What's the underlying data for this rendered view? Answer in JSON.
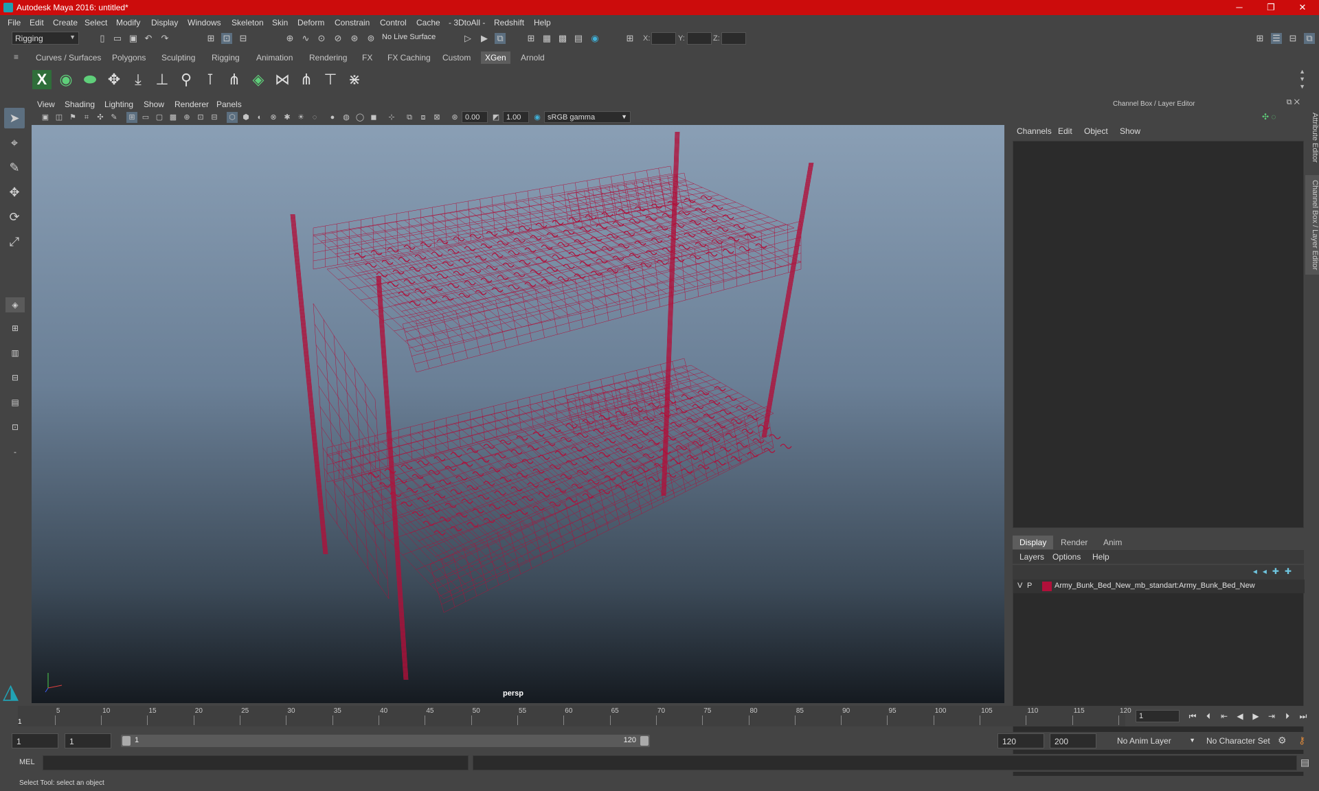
{
  "window": {
    "title": "Autodesk Maya 2016: untitled*",
    "minimize": "─",
    "maximize": "❐",
    "close": "✕"
  },
  "menu": [
    "File",
    "Edit",
    "Create",
    "Select",
    "Modify",
    "Display",
    "Windows",
    "Skeleton",
    "Skin",
    "Deform",
    "Constrain",
    "Control",
    "Cache",
    "- 3DtoAll -",
    "Redshift",
    "Help"
  ],
  "status": {
    "mode": "Rigging",
    "live_surface": "No Live Surface",
    "x_label": "X:",
    "y_label": "Y:",
    "z_label": "Z:"
  },
  "shelf_tabs": [
    "Curves / Surfaces",
    "Polygons",
    "Sculpting",
    "Rigging",
    "Animation",
    "Rendering",
    "FX",
    "FX Caching",
    "Custom",
    "XGen",
    "Arnold"
  ],
  "shelf_active": "XGen",
  "viewport": {
    "menu": [
      "View",
      "Shading",
      "Lighting",
      "Show",
      "Renderer",
      "Panels"
    ],
    "exposure": "0.00",
    "gamma": "1.00",
    "color_space": "sRGB gamma",
    "camera_label": "persp",
    "wire_color": "#b0103a"
  },
  "right_panel": {
    "title": "Channel Box / Layer Editor",
    "menu": [
      "Channels",
      "Edit",
      "Object",
      "Show"
    ],
    "tabs": [
      "Display",
      "Render",
      "Anim"
    ],
    "active_tab": "Display",
    "layer_menu": [
      "Layers",
      "Options",
      "Help"
    ],
    "layer": {
      "v": "V",
      "p": "P",
      "name": "Army_Bunk_Bed_New_mb_standart:Army_Bunk_Bed_New",
      "color": "#b0103a"
    },
    "side_tab_attr": "Attribute Editor",
    "side_tab_channel": "Channel Box / Layer Editor"
  },
  "timeline": {
    "labels": [
      "5",
      "10",
      "15",
      "20",
      "25",
      "30",
      "35",
      "40",
      "45",
      "50",
      "55",
      "60",
      "65",
      "70",
      "75",
      "80",
      "85",
      "90",
      "95",
      "100",
      "105",
      "110",
      "115",
      "120"
    ],
    "start_marker": "1",
    "current_frame": "1"
  },
  "range": {
    "start": "1",
    "playback_start": "1",
    "slider_start": "1",
    "slider_end": "120",
    "playback_end": "120",
    "end": "200",
    "anim_layer": "No Anim Layer",
    "char_set": "No Character Set"
  },
  "cmd": {
    "label": "MEL"
  },
  "help_line": "Select Tool: select an object"
}
